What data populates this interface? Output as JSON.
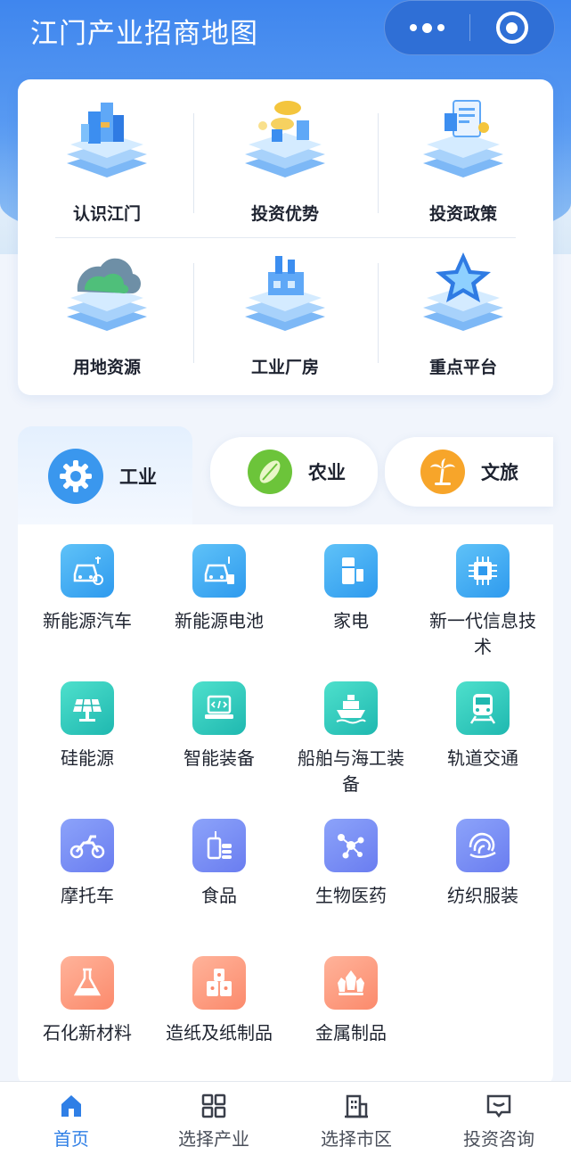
{
  "header": {
    "title": "江门产业招商地图",
    "more_icon": "more-dots-icon",
    "close_icon": "target-close-icon"
  },
  "quick_links": [
    {
      "label": "认识江门",
      "icon": "city-buildings-icon"
    },
    {
      "label": "投资优势",
      "icon": "coins-icon"
    },
    {
      "label": "投资政策",
      "icon": "policy-document-icon"
    },
    {
      "label": "用地资源",
      "icon": "land-resource-icon"
    },
    {
      "label": "工业厂房",
      "icon": "factory-icon"
    },
    {
      "label": "重点平台",
      "icon": "star-platform-icon"
    }
  ],
  "category_tabs": [
    {
      "label": "工业",
      "icon": "gear-icon",
      "active": true
    },
    {
      "label": "农业",
      "icon": "cucumber-icon",
      "active": false
    },
    {
      "label": "文旅",
      "icon": "palm-tree-icon",
      "active": false
    }
  ],
  "industries": [
    {
      "name": "新能源汽车",
      "icon": "ev-car-icon",
      "color": "blue"
    },
    {
      "name": "新能源电池",
      "icon": "ev-battery-car-icon",
      "color": "blue"
    },
    {
      "name": "家电",
      "icon": "fridge-icon",
      "color": "blue"
    },
    {
      "name": "新一代信息技术",
      "icon": "chip-icon",
      "color": "blue"
    },
    {
      "name": "硅能源",
      "icon": "solar-panel-icon",
      "color": "teal"
    },
    {
      "name": "智能装备",
      "icon": "laptop-code-icon",
      "color": "teal"
    },
    {
      "name": "船舶与海工装备",
      "icon": "ship-icon",
      "color": "teal"
    },
    {
      "name": "轨道交通",
      "icon": "train-icon",
      "color": "teal"
    },
    {
      "name": "摩托车",
      "icon": "motorcycle-icon",
      "color": "purple"
    },
    {
      "name": "食品",
      "icon": "food-drink-icon",
      "color": "purple"
    },
    {
      "name": "生物医药",
      "icon": "molecule-icon",
      "color": "purple"
    },
    {
      "name": "纺织服装",
      "icon": "yarn-icon",
      "color": "purple"
    },
    {
      "name": "石化新材料",
      "icon": "flask-icon",
      "color": "salmon"
    },
    {
      "name": "造纸及纸制品",
      "icon": "paper-roll-icon",
      "color": "salmon"
    },
    {
      "name": "金属制品",
      "icon": "crystal-icon",
      "color": "salmon"
    }
  ],
  "bottom_nav": [
    {
      "label": "首页",
      "icon": "home-icon",
      "active": true
    },
    {
      "label": "选择产业",
      "icon": "grid-icon",
      "active": false
    },
    {
      "label": "选择市区",
      "icon": "building-icon",
      "active": false
    },
    {
      "label": "投资咨询",
      "icon": "chat-icon",
      "active": false
    }
  ],
  "colors": {
    "primary": "#2f7fe6",
    "header_blue": "#3f86ee",
    "blue_tile": "#2e9aee",
    "teal_tile": "#1fb8b0",
    "purple_tile": "#6a7df0",
    "salmon_tile": "#fb8a6c"
  }
}
